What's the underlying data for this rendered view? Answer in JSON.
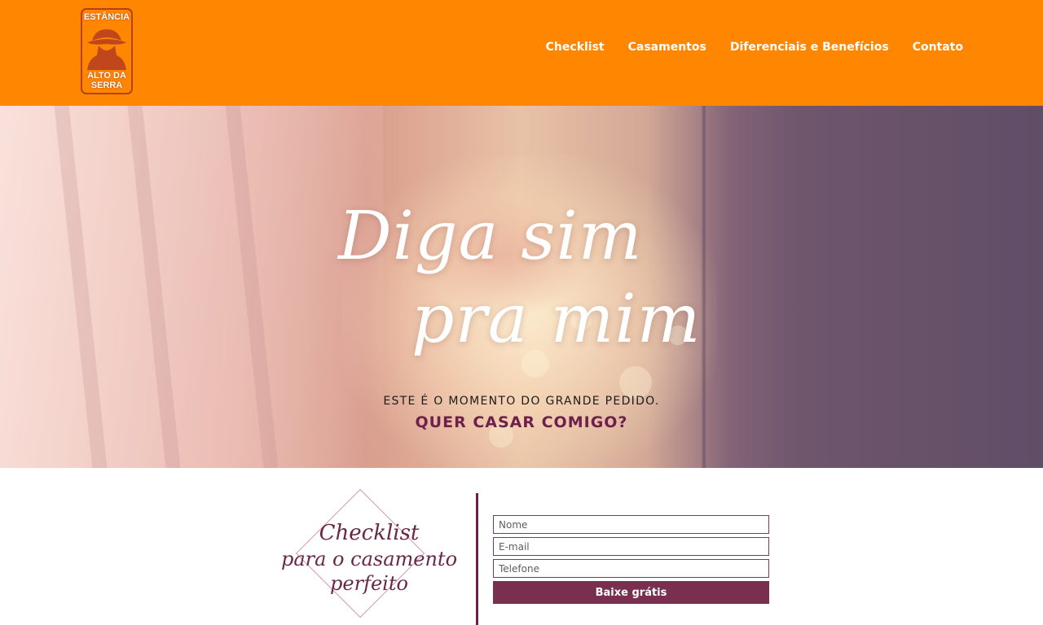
{
  "header": {
    "logo": {
      "top_text": "ESTÂNCIA",
      "bottom_text": "ALTO DA SERRA"
    },
    "nav": [
      {
        "label": "Checklist"
      },
      {
        "label": "Casamentos"
      },
      {
        "label": "Diferenciais e Benefícios"
      },
      {
        "label": "Contato"
      }
    ],
    "background_color": "#ff8600"
  },
  "hero": {
    "script_line_1": "Diga sim",
    "script_line_2": "pra mim",
    "subtitle": "ESTE É O MOMENTO DO GRANDE PEDIDO.",
    "cta": "QUER CASAR COMIGO?",
    "cta_color": "#6e1f4c"
  },
  "checklist": {
    "badge_line_1": "Checklist",
    "badge_line_2": "para o casamento",
    "badge_line_3": "perfeito",
    "form": {
      "name_placeholder": "Nome",
      "email_placeholder": "E-mail",
      "phone_placeholder": "Telefone",
      "submit_label": "Baixe grátis",
      "button_color": "#79304f"
    }
  }
}
